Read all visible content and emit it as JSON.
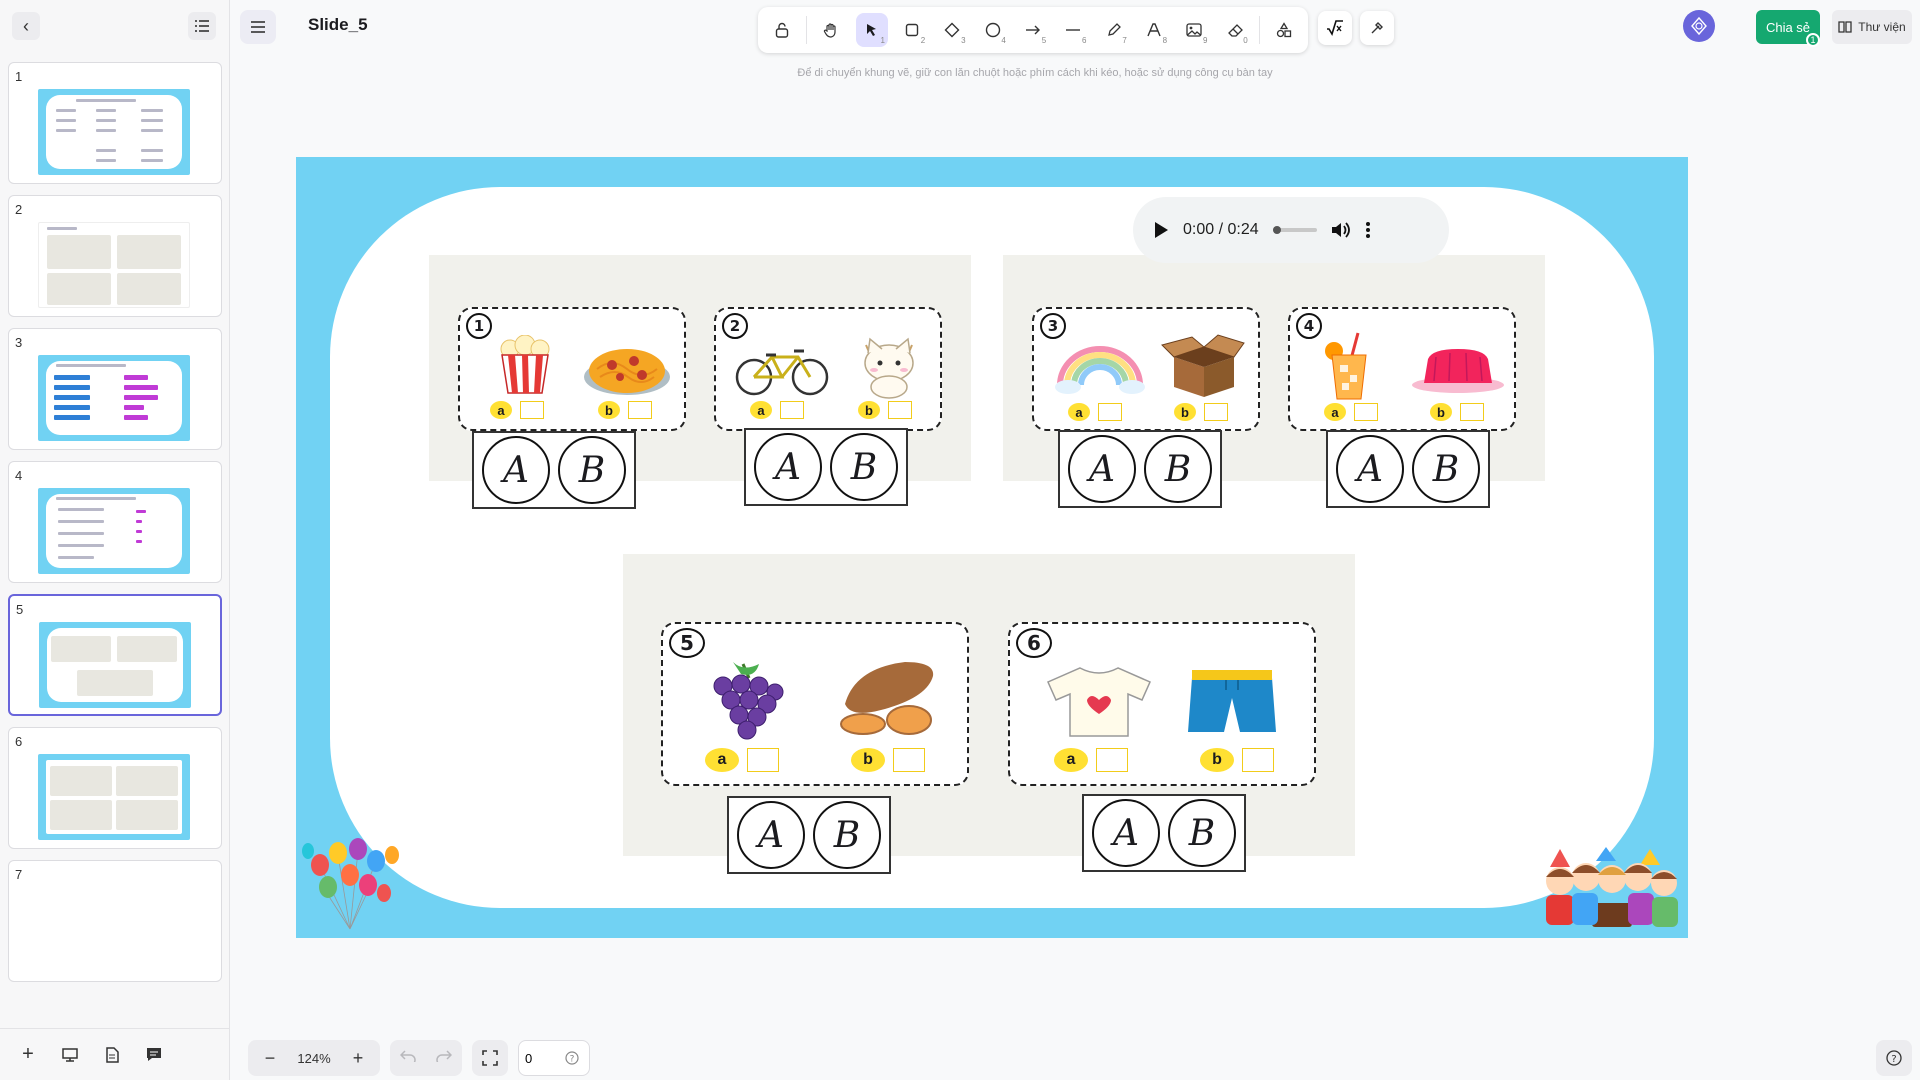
{
  "slide_title": "Slide_5",
  "hint": "Để di chuyển khung vẽ, giữ con lăn chuột hoặc phím cách khi kéo, hoặc sử dụng công cụ bàn tay",
  "toolbar": {
    "keys": [
      "1",
      "2",
      "3",
      "4",
      "5",
      "6",
      "7",
      "8",
      "9",
      "0"
    ]
  },
  "header": {
    "share_label": "Chia sẻ",
    "share_count": "1",
    "library_label": "Thư viện"
  },
  "slides": [
    {
      "num": "1"
    },
    {
      "num": "2"
    },
    {
      "num": "3"
    },
    {
      "num": "4"
    },
    {
      "num": "5"
    },
    {
      "num": "6"
    },
    {
      "num": "7"
    }
  ],
  "active_slide": "5",
  "audio": {
    "time": "0:00 / 0:24"
  },
  "cards": [
    {
      "num": "1",
      "a": "a",
      "b": "b",
      "pic_a": "popcorn",
      "pic_b": "spaghetti"
    },
    {
      "num": "2",
      "a": "a",
      "b": "b",
      "pic_a": "bicycle",
      "pic_b": "cat"
    },
    {
      "num": "3",
      "a": "a",
      "b": "b",
      "pic_a": "rainbow",
      "pic_b": "box"
    },
    {
      "num": "4",
      "a": "a",
      "b": "b",
      "pic_a": "orange-juice",
      "pic_b": "jelly"
    },
    {
      "num": "5",
      "a": "a",
      "b": "b",
      "pic_a": "grapes",
      "pic_b": "sweet-potato"
    },
    {
      "num": "6",
      "a": "a",
      "b": "b",
      "pic_a": "t-shirt",
      "pic_b": "shorts"
    }
  ],
  "answer_choices": {
    "A": "A",
    "B": "B"
  },
  "zoom": "124%",
  "page_input": "0",
  "colors": {
    "accent": "#6965db",
    "slide_bg": "#71d2f3",
    "share": "#15a870",
    "option": "#ffe033"
  }
}
